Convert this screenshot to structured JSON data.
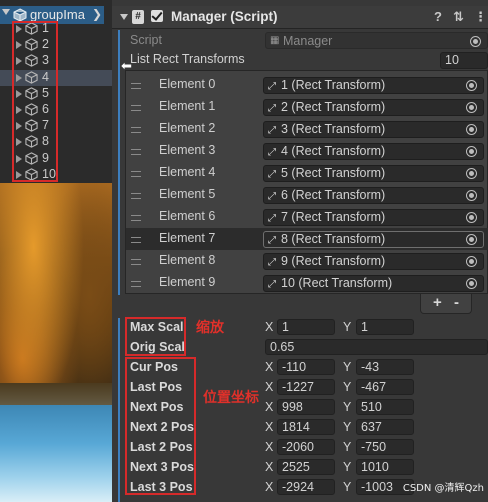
{
  "hierarchy": {
    "root_name": "groupIma",
    "items": [
      "1",
      "2",
      "3",
      "4",
      "5",
      "6",
      "7",
      "8",
      "9",
      "10"
    ],
    "highlighted_index": 3
  },
  "component": {
    "title": "Manager (Script)",
    "script_label": "Script",
    "script_value": "Manager",
    "list_label": "List Rect Transforms",
    "list_count": "10",
    "elements": [
      {
        "label": "Element 0",
        "value": "1 (Rect Transform)"
      },
      {
        "label": "Element 1",
        "value": "2 (Rect Transform)"
      },
      {
        "label": "Element 2",
        "value": "3 (Rect Transform)"
      },
      {
        "label": "Element 3",
        "value": "4 (Rect Transform)"
      },
      {
        "label": "Element 4",
        "value": "5 (Rect Transform)"
      },
      {
        "label": "Element 5",
        "value": "6 (Rect Transform)"
      },
      {
        "label": "Element 6",
        "value": "7 (Rect Transform)"
      },
      {
        "label": "Element 7",
        "value": "8 (Rect Transform)"
      },
      {
        "label": "Element 8",
        "value": "9 (Rect Transform)"
      },
      {
        "label": "Element 9",
        "value": "10 (Rect Transform)"
      }
    ],
    "selected_element": 7,
    "add_label": "+",
    "remove_label": "-"
  },
  "fields": {
    "max_scal": {
      "label": "Max Scal",
      "x": "1",
      "y": "1"
    },
    "orig_scal": {
      "label": "Orig Scal",
      "value": "0.65"
    },
    "cur_pos": {
      "label": "Cur Pos",
      "x": "-110",
      "y": "-43"
    },
    "last_pos": {
      "label": "Last Pos",
      "x": "-1227",
      "y": "-467"
    },
    "next_pos": {
      "label": "Next Pos",
      "x": "998",
      "y": "510"
    },
    "next_2_pos": {
      "label": "Next 2 Pos",
      "x": "1814",
      "y": "637"
    },
    "last_2_pos": {
      "label": "Last 2 Pos",
      "x": "-2060",
      "y": "-750"
    },
    "next_3_pos": {
      "label": "Next 3 Pos",
      "x": "2525",
      "y": "1010"
    },
    "last_3_pos": {
      "label": "Last 3 Pos",
      "x": "-2924",
      "y": "-1003"
    }
  },
  "axis": {
    "x": "X",
    "y": "Y"
  },
  "annotations": {
    "scale": "缩放",
    "position": "位置坐标"
  },
  "watermark": "CSDN @清辉Qzh",
  "colors": {
    "annotation_red": "#d62a2a",
    "selection_blue": "#2c5d87",
    "panel": "#383838"
  }
}
